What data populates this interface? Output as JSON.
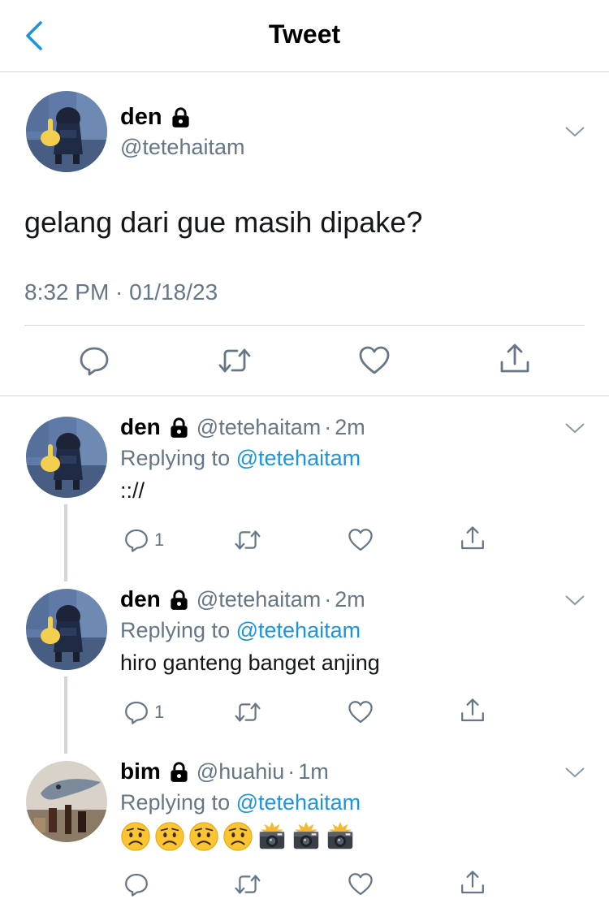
{
  "header": {
    "title": "Tweet"
  },
  "main_tweet": {
    "name": "den",
    "handle": "@tetehaitam",
    "text": "gelang dari gue masih dipake?",
    "timestamp": "8:32 PM · 01/18/23"
  },
  "replies": [
    {
      "name": "den",
      "handle": "@tetehaitam",
      "dot": "·",
      "age": "2m",
      "replying_prefix": "Replying to",
      "replying_to": "@tetehaitam",
      "text": ":://",
      "reply_count": "1"
    },
    {
      "name": "den",
      "handle": "@tetehaitam",
      "dot": "·",
      "age": "2m",
      "replying_prefix": "Replying to",
      "replying_to": "@tetehaitam",
      "text": "hiro ganteng banget anjing",
      "reply_count": "1"
    },
    {
      "name": "bim",
      "handle": "@huahiu",
      "dot": "·",
      "age": "1m",
      "replying_prefix": "Replying to",
      "replying_to": "@tetehaitam",
      "emojis": [
        "worried-face",
        "worried-face",
        "worried-face",
        "worried-face",
        "camera-with-flash",
        "camera-with-flash",
        "camera-with-flash"
      ],
      "reply_count": ""
    }
  ],
  "icons": {
    "back": "chevron-left-icon",
    "lock": "lock-icon",
    "more": "chevron-down-icon",
    "reply": "reply-icon",
    "retweet": "retweet-icon",
    "like": "heart-icon",
    "share": "share-icon"
  },
  "colors": {
    "accent": "#1b95e0",
    "secondary_text": "#657786",
    "divider": "#d3d6d9"
  }
}
